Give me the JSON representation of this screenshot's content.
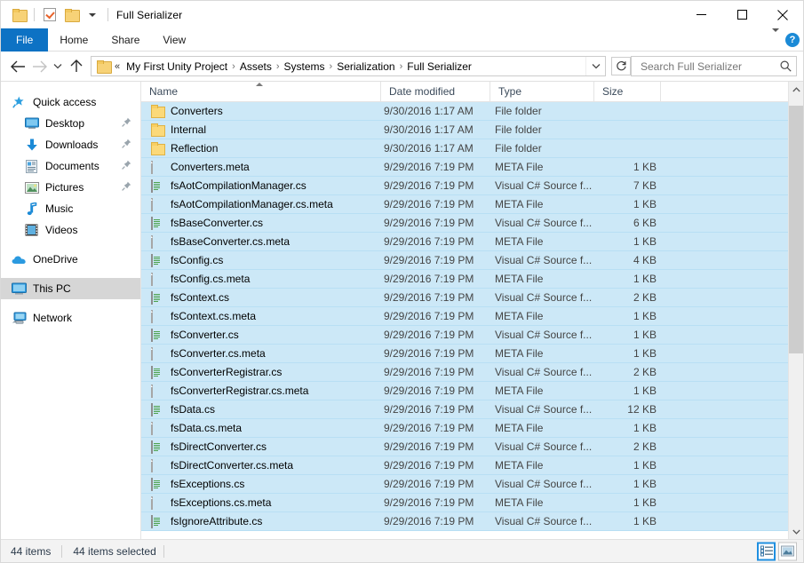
{
  "window": {
    "title": "Full Serializer",
    "quick_access": [
      {
        "name": "folder-icon",
        "label": "Folder"
      },
      {
        "name": "properties-icon",
        "label": "Properties"
      },
      {
        "name": "new-folder-icon",
        "label": "New folder"
      },
      {
        "name": "customize-quick-access-chevron-icon",
        "label": "Customize Quick Access Toolbar"
      }
    ],
    "controls": {
      "minimize": "Minimize",
      "maximize": "Maximize",
      "close": "Close"
    }
  },
  "ribbon": {
    "tabs": [
      {
        "label": "File",
        "active": true
      },
      {
        "label": "Home",
        "active": false
      },
      {
        "label": "Share",
        "active": false
      },
      {
        "label": "View",
        "active": false
      }
    ],
    "expand_label": "Expand the Ribbon",
    "help_label": "?"
  },
  "navbar": {
    "back_label": "Back",
    "forward_label": "Forward",
    "recent_label": "Recent locations",
    "up_label": "Up one level",
    "overflow": "«",
    "breadcrumbs": [
      "My First Unity Project",
      "Assets",
      "Systems",
      "Serialization",
      "Full Serializer"
    ],
    "separator": "›",
    "dropdown_label": "Previous locations",
    "refresh_label": "Refresh"
  },
  "search": {
    "placeholder": "Search Full Serializer",
    "value": ""
  },
  "sidebar": {
    "items": [
      {
        "label": "Quick access",
        "icon": "star-pin-icon",
        "level": "root",
        "pinned": false,
        "selected": false
      },
      {
        "label": "Desktop",
        "icon": "desktop-icon",
        "level": "indent",
        "pinned": true,
        "selected": false
      },
      {
        "label": "Downloads",
        "icon": "download-icon",
        "level": "indent",
        "pinned": true,
        "selected": false
      },
      {
        "label": "Documents",
        "icon": "document-icon",
        "level": "indent",
        "pinned": true,
        "selected": false
      },
      {
        "label": "Pictures",
        "icon": "picture-icon",
        "level": "indent",
        "pinned": true,
        "selected": false
      },
      {
        "label": "Music",
        "icon": "music-icon",
        "level": "indent",
        "pinned": false,
        "selected": false
      },
      {
        "label": "Videos",
        "icon": "video-icon",
        "level": "indent",
        "pinned": false,
        "selected": false
      },
      {
        "label": "OneDrive",
        "icon": "cloud-icon",
        "level": "root",
        "pinned": false,
        "selected": false
      },
      {
        "label": "This PC",
        "icon": "monitor-icon",
        "level": "root",
        "pinned": false,
        "selected": true
      },
      {
        "label": "Network",
        "icon": "network-icon",
        "level": "root",
        "pinned": false,
        "selected": false
      }
    ]
  },
  "filelist": {
    "columns": [
      {
        "key": "name",
        "label": "Name",
        "sorted": true,
        "sort_dir": "asc"
      },
      {
        "key": "date",
        "label": "Date modified"
      },
      {
        "key": "type",
        "label": "Type"
      },
      {
        "key": "size",
        "label": "Size"
      }
    ],
    "rows": [
      {
        "name": "Converters",
        "date": "9/30/2016 1:17 AM",
        "type": "File folder",
        "size": "",
        "icon": "folder",
        "selected": true
      },
      {
        "name": "Internal",
        "date": "9/30/2016 1:17 AM",
        "type": "File folder",
        "size": "",
        "icon": "folder",
        "selected": true
      },
      {
        "name": "Reflection",
        "date": "9/30/2016 1:17 AM",
        "type": "File folder",
        "size": "",
        "icon": "folder",
        "selected": true
      },
      {
        "name": "Converters.meta",
        "date": "9/29/2016 7:19 PM",
        "type": "META File",
        "size": "1 KB",
        "icon": "file",
        "selected": true
      },
      {
        "name": "fsAotCompilationManager.cs",
        "date": "9/29/2016 7:19 PM",
        "type": "Visual C# Source f...",
        "size": "7 KB",
        "icon": "cs",
        "selected": true
      },
      {
        "name": "fsAotCompilationManager.cs.meta",
        "date": "9/29/2016 7:19 PM",
        "type": "META File",
        "size": "1 KB",
        "icon": "file",
        "selected": true
      },
      {
        "name": "fsBaseConverter.cs",
        "date": "9/29/2016 7:19 PM",
        "type": "Visual C# Source f...",
        "size": "6 KB",
        "icon": "cs",
        "selected": true
      },
      {
        "name": "fsBaseConverter.cs.meta",
        "date": "9/29/2016 7:19 PM",
        "type": "META File",
        "size": "1 KB",
        "icon": "file",
        "selected": true
      },
      {
        "name": "fsConfig.cs",
        "date": "9/29/2016 7:19 PM",
        "type": "Visual C# Source f...",
        "size": "4 KB",
        "icon": "cs",
        "selected": true
      },
      {
        "name": "fsConfig.cs.meta",
        "date": "9/29/2016 7:19 PM",
        "type": "META File",
        "size": "1 KB",
        "icon": "file",
        "selected": true
      },
      {
        "name": "fsContext.cs",
        "date": "9/29/2016 7:19 PM",
        "type": "Visual C# Source f...",
        "size": "2 KB",
        "icon": "cs",
        "selected": true
      },
      {
        "name": "fsContext.cs.meta",
        "date": "9/29/2016 7:19 PM",
        "type": "META File",
        "size": "1 KB",
        "icon": "file",
        "selected": true
      },
      {
        "name": "fsConverter.cs",
        "date": "9/29/2016 7:19 PM",
        "type": "Visual C# Source f...",
        "size": "1 KB",
        "icon": "cs",
        "selected": true
      },
      {
        "name": "fsConverter.cs.meta",
        "date": "9/29/2016 7:19 PM",
        "type": "META File",
        "size": "1 KB",
        "icon": "file",
        "selected": true
      },
      {
        "name": "fsConverterRegistrar.cs",
        "date": "9/29/2016 7:19 PM",
        "type": "Visual C# Source f...",
        "size": "2 KB",
        "icon": "cs",
        "selected": true
      },
      {
        "name": "fsConverterRegistrar.cs.meta",
        "date": "9/29/2016 7:19 PM",
        "type": "META File",
        "size": "1 KB",
        "icon": "file",
        "selected": true
      },
      {
        "name": "fsData.cs",
        "date": "9/29/2016 7:19 PM",
        "type": "Visual C# Source f...",
        "size": "12 KB",
        "icon": "cs",
        "selected": true
      },
      {
        "name": "fsData.cs.meta",
        "date": "9/29/2016 7:19 PM",
        "type": "META File",
        "size": "1 KB",
        "icon": "file",
        "selected": true
      },
      {
        "name": "fsDirectConverter.cs",
        "date": "9/29/2016 7:19 PM",
        "type": "Visual C# Source f...",
        "size": "2 KB",
        "icon": "cs",
        "selected": true
      },
      {
        "name": "fsDirectConverter.cs.meta",
        "date": "9/29/2016 7:19 PM",
        "type": "META File",
        "size": "1 KB",
        "icon": "file",
        "selected": true
      },
      {
        "name": "fsExceptions.cs",
        "date": "9/29/2016 7:19 PM",
        "type": "Visual C# Source f...",
        "size": "1 KB",
        "icon": "cs",
        "selected": true
      },
      {
        "name": "fsExceptions.cs.meta",
        "date": "9/29/2016 7:19 PM",
        "type": "META File",
        "size": "1 KB",
        "icon": "file",
        "selected": true
      },
      {
        "name": "fsIgnoreAttribute.cs",
        "date": "9/29/2016 7:19 PM",
        "type": "Visual C# Source f...",
        "size": "1 KB",
        "icon": "cs",
        "selected": true
      }
    ]
  },
  "statusbar": {
    "item_count": "44 items",
    "selection_count": "44 items selected",
    "views": [
      {
        "name": "details-view-button",
        "label": "Details view",
        "active": true
      },
      {
        "name": "large-icons-view-button",
        "label": "Large icons view",
        "active": false
      }
    ]
  },
  "colors": {
    "accent": "#0d72c4",
    "selection": "#cce8f7",
    "selection_border": "#b8dff4",
    "folder": "#fbd979",
    "sidebar_selected": "#d6d6d6",
    "help": "#1b8ad6"
  }
}
